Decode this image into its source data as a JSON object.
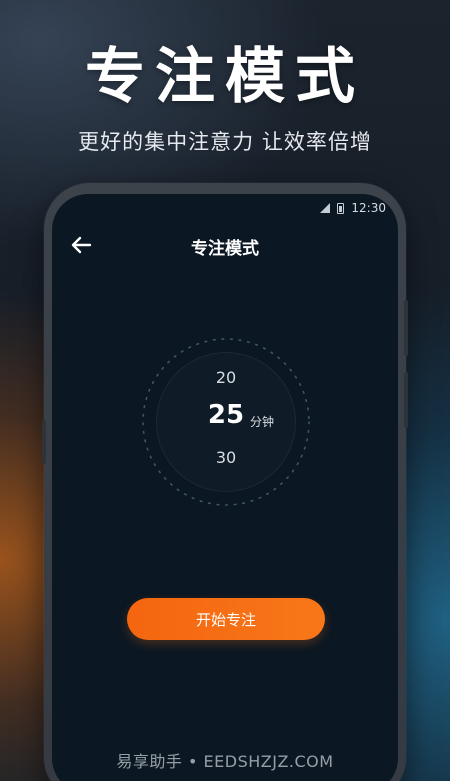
{
  "promo": {
    "headline": "专注模式",
    "subline": "更好的集中注意力 让效率倍增"
  },
  "status_bar": {
    "time": "12:30",
    "icons": [
      "signal-icon",
      "battery-icon"
    ]
  },
  "nav": {
    "back_icon": "arrow-left-icon",
    "title": "专注模式"
  },
  "timer_picker": {
    "prev_value": "20",
    "selected_value": "25",
    "unit": "分钟",
    "next_value": "30"
  },
  "actions": {
    "start_label": "开始专注"
  },
  "watermark": "易享助手 • EEDSHZJZ.COM",
  "colors": {
    "accent": "#F56A12",
    "screen_bg": "#0B1722",
    "text": "#FFFFFF"
  }
}
